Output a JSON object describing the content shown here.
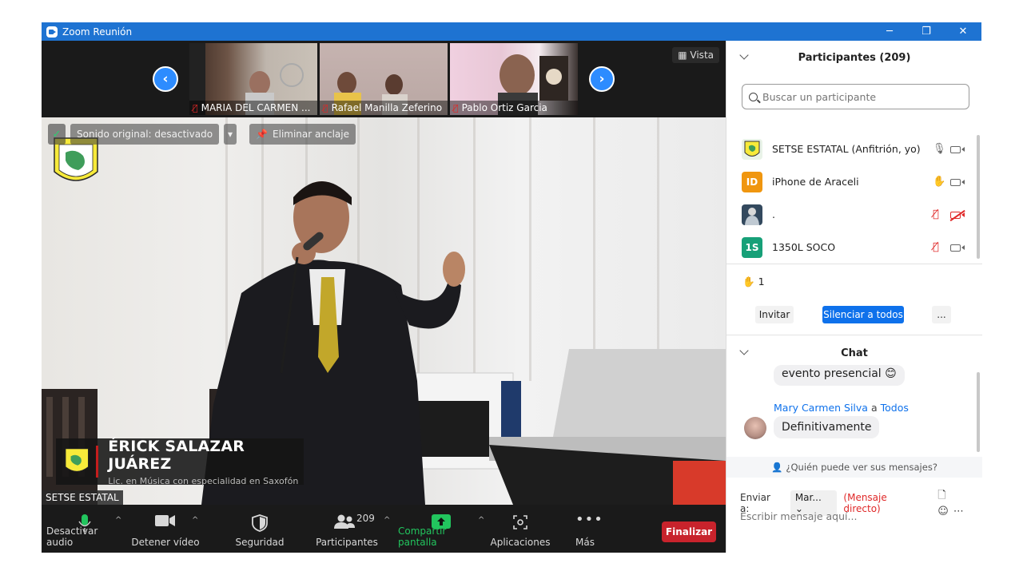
{
  "window": {
    "title": "Zoom Reunión",
    "minimize": "─",
    "restore": "❐",
    "close": "✕"
  },
  "thumbnails": [
    {
      "name": "MARIA DEL CARMEN ..."
    },
    {
      "name": "Rafael Manilla Zeferino"
    },
    {
      "name": "Pablo Ortiz Garcia"
    }
  ],
  "view_button": "Vista",
  "overlay": {
    "original_sound": "Sonido original: desactivado",
    "unpin": "Eliminar anclaje"
  },
  "lower_third": {
    "name": "ÉRICK SALAZAR JUÁREZ",
    "subtitle": "Lic. en Música con especialidad en Saxofón"
  },
  "speaker_label": "SETSE ESTATAL",
  "toolbar": {
    "audio": "Desactivar audio",
    "video": "Detener vídeo",
    "security": "Seguridad",
    "participants": "Participantes",
    "participants_count": "209",
    "share": "Compartir pantalla",
    "apps": "Aplicaciones",
    "more": "Más",
    "end": "Finalizar"
  },
  "participants_panel": {
    "title": "Participantes (209)",
    "search_placeholder": "Buscar un participante",
    "rows": [
      {
        "name": "SETSE ESTATAL (Anfitrión, yo)",
        "initials": ""
      },
      {
        "name": "iPhone de Araceli",
        "initials": "ID"
      },
      {
        "name": ".",
        "initials": ""
      },
      {
        "name": "1350L SOCO",
        "initials": "1S"
      }
    ],
    "raised_hands": "1",
    "invite": "Invitar",
    "mute_all": "Silenciar a todos",
    "more": "..."
  },
  "chat": {
    "title": "Chat",
    "prev_message": "evento presencial 😊",
    "sender": "Mary Carmen Silva",
    "to_word": "a",
    "recipient": "Todos",
    "message": "Definitivamente",
    "who_can_see": "¿Quién puede ver sus mensajes?",
    "send_to_label": "Enviar a:",
    "send_to_value": "Mar...",
    "direct_label": "(Mensaje directo)",
    "input_placeholder": "Escribir mensaje aquí..."
  },
  "colors": {
    "titlebar": "#1e73d2",
    "accent": "#0e71eb",
    "end_button": "#c8232c",
    "share_green": "#22c55e",
    "avatar_orange": "#f0960f",
    "avatar_teal": "#17a078"
  }
}
